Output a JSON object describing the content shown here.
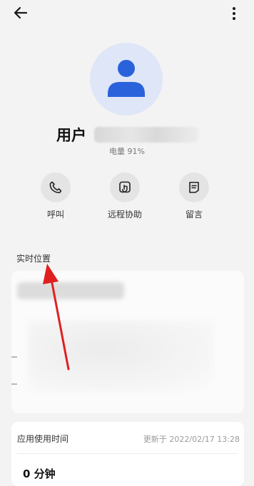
{
  "header": {
    "back_icon": "arrow-left-icon",
    "more_icon": "more-vertical-icon"
  },
  "profile": {
    "avatar_icon": "person-icon",
    "name_prefix": "用户",
    "battery_text": "电量 91%"
  },
  "actions": [
    {
      "label": "呼叫",
      "icon": "phone-icon"
    },
    {
      "label": "远程协助",
      "icon": "remote-assist-icon"
    },
    {
      "label": "留言",
      "icon": "message-note-icon"
    }
  ],
  "location": {
    "section_title": "实时位置"
  },
  "usage": {
    "title": "应用使用时间",
    "updated": "更新于 2022/02/17 13:28",
    "value": "0 分钟"
  },
  "colors": {
    "accent": "#2a62dc",
    "annotation_arrow": "#e02020",
    "background": "#f3f3f3"
  }
}
